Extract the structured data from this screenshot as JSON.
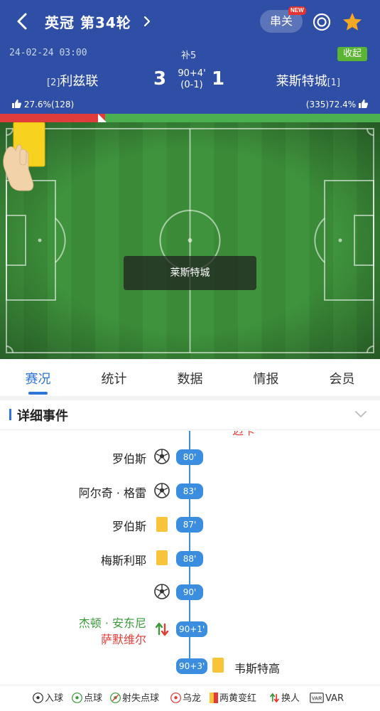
{
  "header": {
    "title": "英冠 第34轮",
    "parlay_label": "串关",
    "new_badge": "NEW",
    "date": "24-02-24 03:00",
    "stoppage": "补5",
    "collapse_label": "收起",
    "home": {
      "rank": "[2]",
      "name": "利兹联",
      "score": "3"
    },
    "away": {
      "rank": "[1]",
      "name": "莱斯特城",
      "score": "1"
    },
    "match_time": "90+4'",
    "half_score": "(0-1)",
    "home_vote": "27.6%(128)",
    "away_vote": "(335)72.4%",
    "vote_split": {
      "home": 0.276,
      "away": 0.724
    }
  },
  "pitch": {
    "event_team": "莱斯特城",
    "event_type": "yellow-card"
  },
  "tabs": [
    {
      "label": "赛况",
      "active": true
    },
    {
      "label": "统计",
      "active": false
    },
    {
      "label": "数据",
      "active": false
    },
    {
      "label": "情报",
      "active": false
    },
    {
      "label": "会员",
      "active": false
    }
  ],
  "section": {
    "title": "详细事件",
    "cut_text": "迈卡"
  },
  "events": [
    {
      "time": "80'",
      "side": "home",
      "type": "goal",
      "player": "罗伯斯"
    },
    {
      "time": "83'",
      "side": "home",
      "type": "goal",
      "player": "阿尔奇 · 格雷"
    },
    {
      "time": "87'",
      "side": "home",
      "type": "yellow",
      "player": "罗伯斯"
    },
    {
      "time": "88'",
      "side": "home",
      "type": "yellow",
      "player": "梅斯利耶"
    },
    {
      "time": "90'",
      "side": "home",
      "type": "goal",
      "player": ""
    },
    {
      "time": "90+1'",
      "side": "home",
      "type": "sub",
      "player_in": "杰顿 · 安东尼",
      "player_out": "萨默维尔"
    },
    {
      "time": "90+3'",
      "side": "away",
      "type": "yellow",
      "player": "韦斯特高"
    }
  ],
  "legend": [
    {
      "icon": "goal-icon",
      "label": "入球"
    },
    {
      "icon": "penalty-icon",
      "label": "点球"
    },
    {
      "icon": "penalty-miss-icon",
      "label": "射失点球"
    },
    {
      "icon": "own-goal-icon",
      "label": "乌龙"
    },
    {
      "icon": "second-yellow-icon",
      "label": "两黄变红"
    },
    {
      "icon": "substitution-icon",
      "label": "换人"
    },
    {
      "icon": "var-icon",
      "label": "VAR"
    }
  ],
  "colors": {
    "header": "#2f4fa6",
    "accent": "#2e73d8",
    "pitch": "#3c8e3a",
    "yellow_card": "#f8c43a",
    "collapse": "#59b533"
  }
}
